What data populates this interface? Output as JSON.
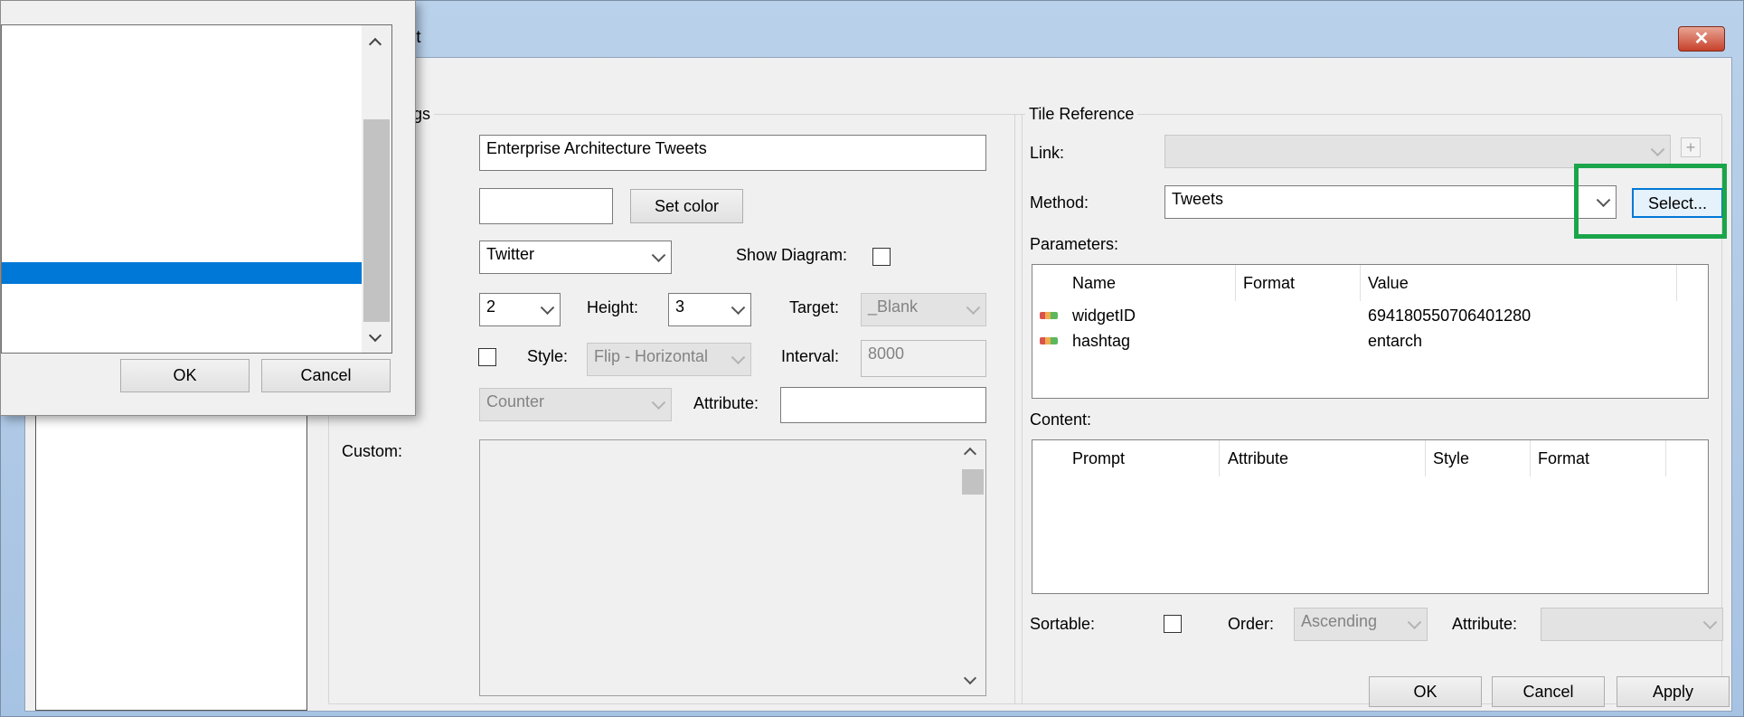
{
  "window": {
    "title_fragment": "lt",
    "close_label": "✕"
  },
  "tile_settings": {
    "group_label_fragment": "gs",
    "caption_value": "Enterprise Architecture Tweets",
    "color_value": "",
    "set_color_label": "Set color",
    "type_value": "Twitter",
    "show_diagram_label": "Show Diagram:",
    "width_value": "2",
    "height_label": "Height:",
    "height_value": "3",
    "target_label": "Target:",
    "target_value": "_Blank",
    "style_label_fragment": ":",
    "style_label": "Style:",
    "style_value": "Flip - Horizontal",
    "interval_label": "Interval:",
    "interval_value": "8000",
    "counter_value": "Counter",
    "attribute_label": "Attribute:",
    "attribute_value": "",
    "custom_label": "Custom:",
    "custom_value": ""
  },
  "tile_reference": {
    "group_label": "Tile Reference",
    "link_label": "Link:",
    "link_value": "",
    "link_add": "+",
    "method_label": "Method:",
    "method_value": "Tweets",
    "select_label": "Select...",
    "parameters_label": "Parameters:",
    "parameters_columns": [
      "Name",
      "Format",
      "Value"
    ],
    "parameters_rows": [
      {
        "name": "widgetID",
        "format": "",
        "value": "694180550706401280"
      },
      {
        "name": "hashtag",
        "format": "",
        "value": "entarch"
      }
    ],
    "content_label": "Content:",
    "content_columns": [
      "Prompt",
      "Attribute",
      "Style",
      "Format"
    ],
    "sortable_label": "Sortable:",
    "order_label": "Order:",
    "order_value": "Ascending",
    "attribute_label": "Attribute:",
    "attribute_value": ""
  },
  "buttons": {
    "ok": "OK",
    "cancel": "Cancel",
    "apply": "Apply"
  },
  "popup": {
    "ok": "OK",
    "cancel": "Cancel"
  },
  "colors": {
    "accent": "#0078d7",
    "highlight_box": "#1aa54a"
  }
}
